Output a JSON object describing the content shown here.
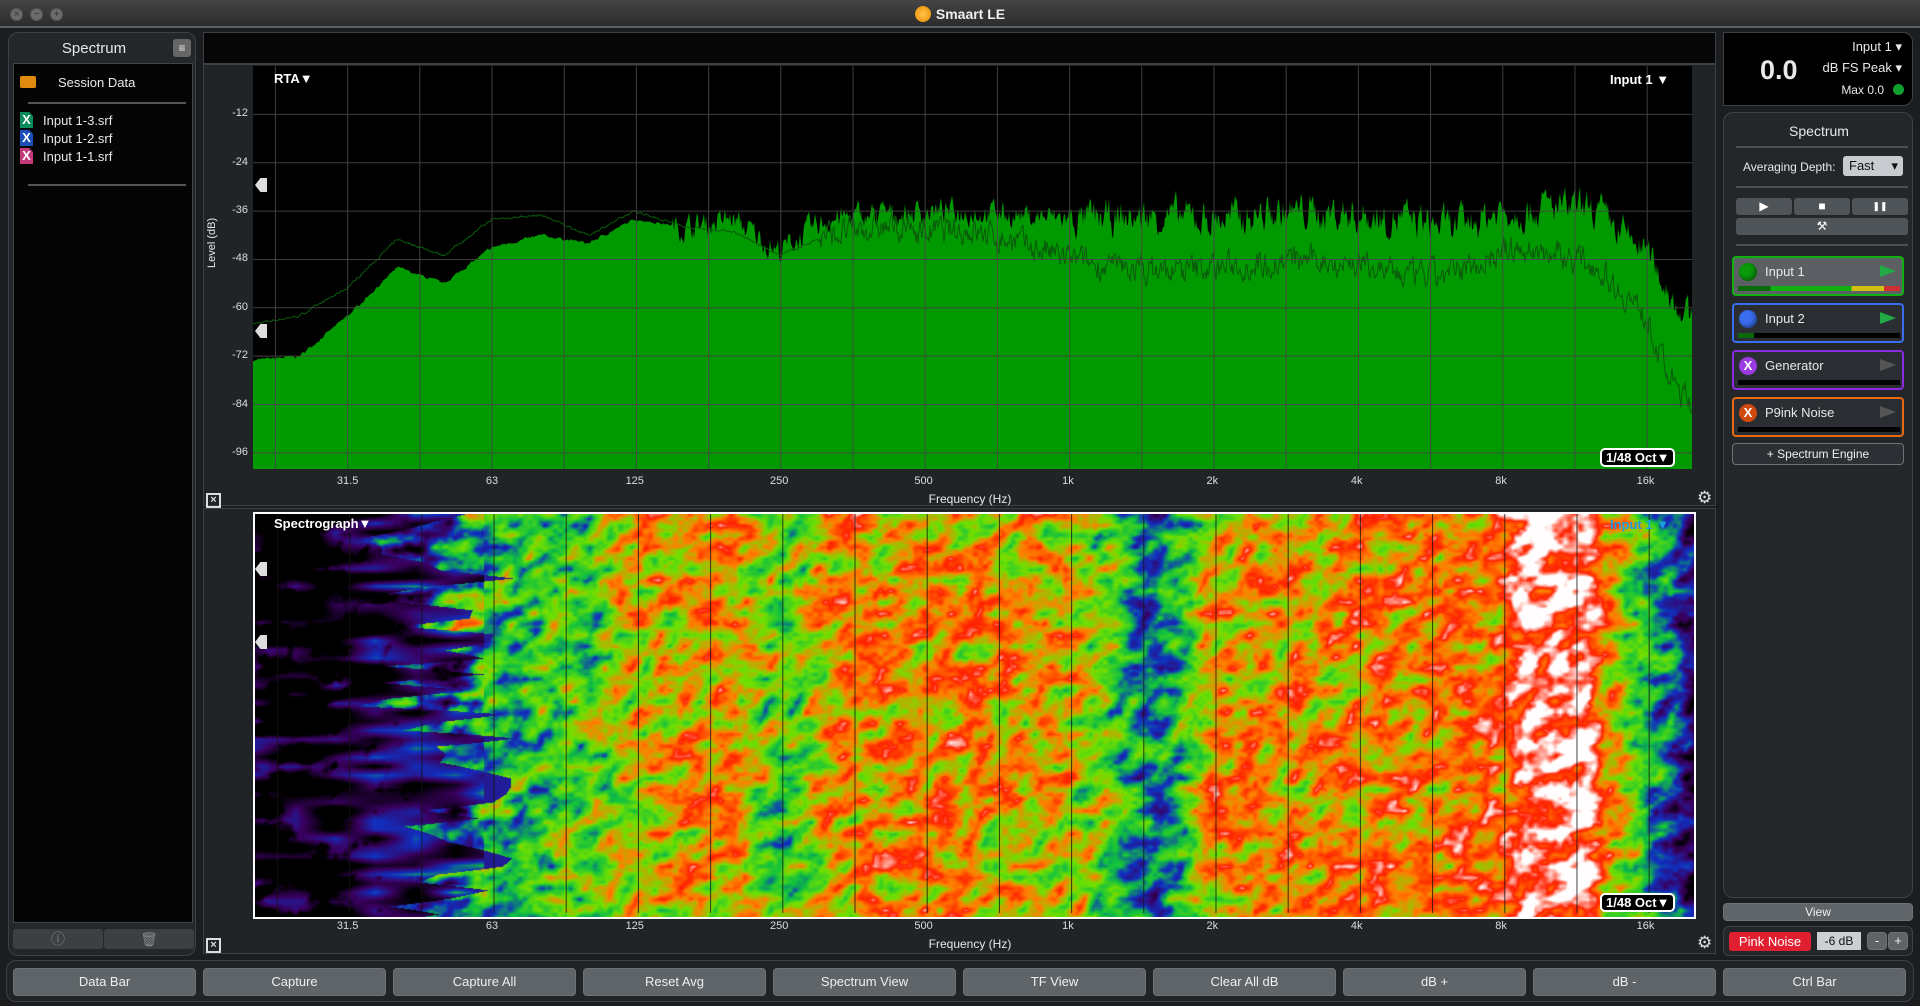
{
  "window": {
    "title": "Smaart LE",
    "logo_text": "LE"
  },
  "left_panel": {
    "title": "Spectrum",
    "menu_icon": "hamburger-icon",
    "root": "Session Data",
    "files": [
      {
        "name": "Input 1-3.srf",
        "color": "#0b8a5c"
      },
      {
        "name": "Input 1-2.srf",
        "color": "#1a4fb8"
      },
      {
        "name": "Input 1-1.srf",
        "color": "#c23a7a"
      }
    ],
    "info_icon": "info-icon",
    "trash_icon": "trash-icon"
  },
  "rta": {
    "mode_label": "RTA▼",
    "source_label": "Input 1 ▼",
    "resolution_label": "1/48 Oct▼",
    "ylabel": "Level (dB)",
    "xlabel": "Frequency (Hz)"
  },
  "spectrograph": {
    "mode_label": "Spectrograph▼",
    "source_label": "Input 1 ▼",
    "resolution_label": "1/48 Oct▼",
    "xlabel": "Frequency (Hz)"
  },
  "chart_data": [
    {
      "type": "area",
      "title": "",
      "xlabel": "Frequency (Hz)",
      "ylabel": "Level (dB)",
      "xscale": "log",
      "xlim": [
        20,
        20000
      ],
      "ylim": [
        -100,
        0
      ],
      "grid": true,
      "yticks": [
        -12,
        -24,
        -36,
        -48,
        -60,
        -72,
        -84,
        -96
      ],
      "xticks": [
        "31.5",
        "63",
        "125",
        "250",
        "500",
        "1k",
        "2k",
        "4k",
        "8k",
        "16k"
      ],
      "xtick_values": [
        31.5,
        63,
        125,
        250,
        500,
        1000,
        2000,
        4000,
        8000,
        16000
      ],
      "fill_color": "#009a00",
      "line_color": "#0a5a0a",
      "x": [
        20,
        25,
        31.5,
        40,
        50,
        63,
        80,
        100,
        125,
        160,
        200,
        250,
        315,
        400,
        500,
        630,
        800,
        1000,
        1250,
        1600,
        2000,
        2500,
        3150,
        4000,
        5000,
        6300,
        8000,
        10000,
        12500,
        16000,
        18000,
        20000
      ],
      "series": [
        {
          "values": [
            -73,
            -72,
            -62,
            -50,
            -54,
            -45,
            -42,
            -44,
            -38,
            -40,
            -38,
            -46,
            -38,
            -37,
            -36,
            -36,
            -37,
            -38,
            -38,
            -37,
            -38,
            -37,
            -36,
            -37,
            -38,
            -40,
            -36,
            -35,
            -36,
            -46,
            -56,
            -64
          ]
        },
        {
          "values": [
            -64,
            -62,
            -55,
            -43,
            -47,
            -38,
            -37,
            -42,
            -36,
            -40,
            -41,
            -47,
            -42,
            -40,
            -41,
            -41,
            -44,
            -48,
            -50,
            -51,
            -50,
            -49,
            -48,
            -49,
            -52,
            -52,
            -46,
            -46,
            -49,
            -62,
            -78,
            -84
          ]
        }
      ]
    },
    {
      "type": "heatmap",
      "title": "",
      "xlabel": "Frequency (Hz)",
      "xscale": "log",
      "xlim": [
        20,
        20000
      ],
      "xticks": [
        "31.5",
        "63",
        "125",
        "250",
        "500",
        "1k",
        "2k",
        "4k",
        "8k",
        "16k"
      ],
      "colormap": [
        "#000000",
        "#3a0060",
        "#1030c0",
        "#10c040",
        "#70e000",
        "#ff8000",
        "#ff2000",
        "#ffffff"
      ],
      "x": [
        20,
        28,
        35,
        45,
        63,
        100,
        125,
        200,
        250,
        315,
        500,
        1000,
        1200,
        1500,
        1800,
        2000,
        4000,
        8000,
        9000,
        12000,
        13000,
        16000,
        18000,
        20000
      ],
      "intensity": [
        0,
        0,
        0.2,
        0.35,
        0.45,
        0.5,
        0.65,
        0.7,
        0.5,
        0.7,
        0.72,
        0.65,
        0.5,
        0.35,
        0.5,
        0.7,
        0.72,
        0.75,
        0.95,
        0.95,
        0.72,
        0.45,
        0.3,
        0.15
      ]
    }
  ],
  "meter": {
    "source": "Input 1",
    "value": "0.0",
    "unit": "dB FS Peak",
    "max": "Max 0.0",
    "status_color": "#10a030"
  },
  "spectrum_panel": {
    "title": "Spectrum",
    "averaging_label": "Averaging Depth:",
    "averaging_value": "Fast",
    "transport": {
      "play_icon": "▶",
      "stop_icon": "■",
      "pause_icon": "❚❚",
      "tools_icon": "⚒"
    },
    "engines": [
      {
        "name": "Input 1",
        "color": "#10b010",
        "dot": "#0a9a0a",
        "mark": "",
        "play": "#22aa44",
        "active": true,
        "level": 1.0
      },
      {
        "name": "Input 2",
        "color": "#3a6ef0",
        "dot": "#3a6ef0",
        "mark": "",
        "play": "#22aa44",
        "active": false,
        "level": 0.1
      },
      {
        "name": "Generator",
        "color": "#8a2be2",
        "dot": "#9a3ae0",
        "mark": "X",
        "play": "#555555",
        "active": false,
        "level": 0
      },
      {
        "name": "P9ink Noise",
        "color": "#e86a10",
        "dot": "#d04a10",
        "mark": "X",
        "play": "#555555",
        "active": false,
        "level": 0
      }
    ],
    "add_engine": "+ Spectrum Engine"
  },
  "view_button": "View",
  "generator": {
    "label": "Pink Noise",
    "level": "-6 dB",
    "minus": "-",
    "plus": "+",
    "color": "#e02030"
  },
  "bottom_buttons": [
    "Data Bar",
    "Capture",
    "Capture All",
    "Reset Avg",
    "Spectrum View",
    "TF View",
    "Clear All dB",
    "dB +",
    "dB -",
    "Ctrl Bar"
  ]
}
